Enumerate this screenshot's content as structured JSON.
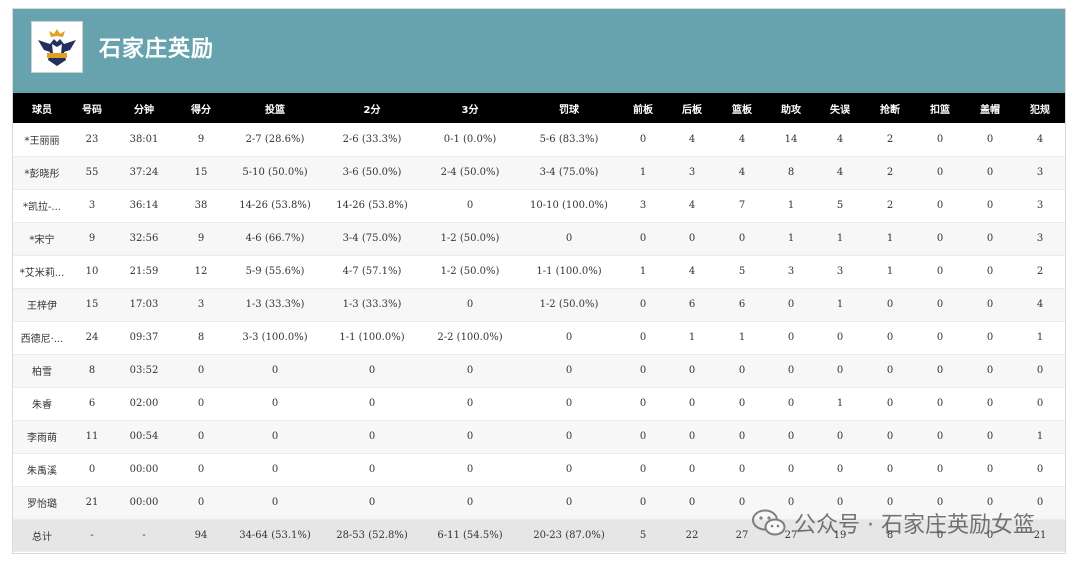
{
  "header": {
    "team_name": "石家庄英励",
    "bg_color": "#66a3ae"
  },
  "table": {
    "columns": [
      "球员",
      "号码",
      "分钟",
      "得分",
      "投篮",
      "2分",
      "3分",
      "罚球",
      "前板",
      "后板",
      "篮板",
      "助攻",
      "失误",
      "抢断",
      "扣篮",
      "盖帽",
      "犯规"
    ],
    "rows": [
      [
        "*王丽丽",
        "23",
        "38:01",
        "9",
        "2-7 (28.6%)",
        "2-6 (33.3%)",
        "0-1 (0.0%)",
        "5-6 (83.3%)",
        "0",
        "4",
        "4",
        "14",
        "4",
        "2",
        "0",
        "0",
        "4"
      ],
      [
        "*彭晓彤",
        "55",
        "37:24",
        "15",
        "5-10 (50.0%)",
        "3-6 (50.0%)",
        "2-4 (50.0%)",
        "3-4 (75.0%)",
        "1",
        "3",
        "4",
        "8",
        "4",
        "2",
        "0",
        "0",
        "3"
      ],
      [
        "*凯拉-...",
        "3",
        "36:14",
        "38",
        "14-26 (53.8%)",
        "14-26 (53.8%)",
        "0",
        "10-10 (100.0%)",
        "3",
        "4",
        "7",
        "1",
        "5",
        "2",
        "0",
        "0",
        "3"
      ],
      [
        "*宋宁",
        "9",
        "32:56",
        "9",
        "4-6 (66.7%)",
        "3-4 (75.0%)",
        "1-2 (50.0%)",
        "0",
        "0",
        "0",
        "0",
        "1",
        "1",
        "1",
        "0",
        "0",
        "3"
      ],
      [
        "*艾米莉...",
        "10",
        "21:59",
        "12",
        "5-9 (55.6%)",
        "4-7 (57.1%)",
        "1-2 (50.0%)",
        "1-1 (100.0%)",
        "1",
        "4",
        "5",
        "3",
        "3",
        "1",
        "0",
        "0",
        "2"
      ],
      [
        "王梓伊",
        "15",
        "17:03",
        "3",
        "1-3 (33.3%)",
        "1-3 (33.3%)",
        "0",
        "1-2 (50.0%)",
        "0",
        "6",
        "6",
        "0",
        "1",
        "0",
        "0",
        "0",
        "4"
      ],
      [
        "西德尼·...",
        "24",
        "09:37",
        "8",
        "3-3 (100.0%)",
        "1-1 (100.0%)",
        "2-2 (100.0%)",
        "0",
        "0",
        "1",
        "1",
        "0",
        "0",
        "0",
        "0",
        "0",
        "1"
      ],
      [
        "柏雪",
        "8",
        "03:52",
        "0",
        "0",
        "0",
        "0",
        "0",
        "0",
        "0",
        "0",
        "0",
        "0",
        "0",
        "0",
        "0",
        "0"
      ],
      [
        "朱睿",
        "6",
        "02:00",
        "0",
        "0",
        "0",
        "0",
        "0",
        "0",
        "0",
        "0",
        "0",
        "1",
        "0",
        "0",
        "0",
        "0"
      ],
      [
        "李雨萌",
        "11",
        "00:54",
        "0",
        "0",
        "0",
        "0",
        "0",
        "0",
        "0",
        "0",
        "0",
        "0",
        "0",
        "0",
        "0",
        "1"
      ],
      [
        "朱禹溪",
        "0",
        "00:00",
        "0",
        "0",
        "0",
        "0",
        "0",
        "0",
        "0",
        "0",
        "0",
        "0",
        "0",
        "0",
        "0",
        "0"
      ],
      [
        "罗怡璐",
        "21",
        "00:00",
        "0",
        "0",
        "0",
        "0",
        "0",
        "0",
        "0",
        "0",
        "0",
        "0",
        "0",
        "0",
        "0",
        "0"
      ]
    ],
    "total": [
      "总计",
      "-",
      "-",
      "94",
      "34-64 (53.1%)",
      "28-53 (52.8%)",
      "6-11 (54.5%)",
      "20-23 (87.0%)",
      "5",
      "22",
      "27",
      "27",
      "19",
      "8",
      "0",
      "0",
      "21"
    ]
  },
  "watermark": {
    "text": "公众号 · 石家庄英励女篮",
    "icon": "wechat-icon"
  }
}
